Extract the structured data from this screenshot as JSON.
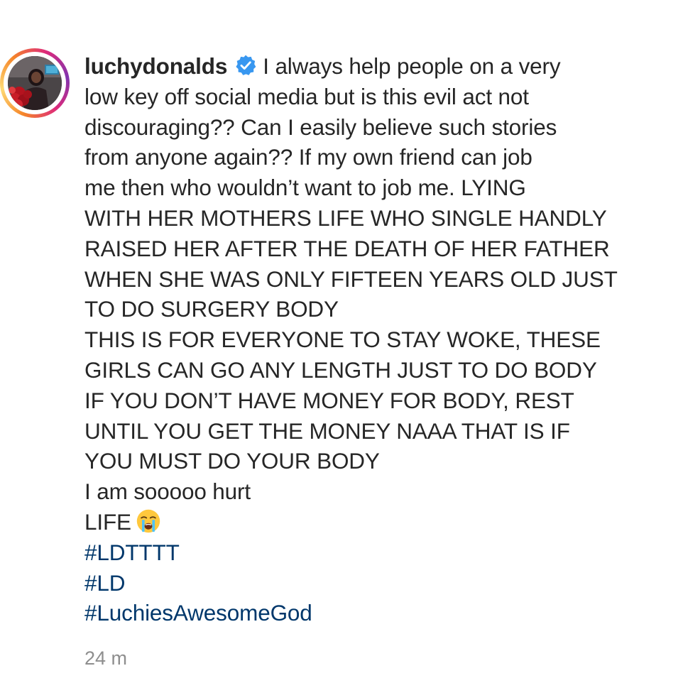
{
  "post": {
    "username": "luchydonalds",
    "verified_icon": "verified-badge-icon",
    "caption_first_line": "I always help people on a very",
    "caption_lines": [
      "low key off social media but is this evil act not",
      "discouraging?? Can I easily believe such stories",
      "from anyone again?? If my own friend can job",
      "me then who wouldn’t want to job me. LYING",
      "WITH HER MOTHERS LIFE WHO SINGLE HANDLY",
      "RAISED HER AFTER THE DEATH OF HER FATHER",
      "WHEN SHE WAS ONLY FIFTEEN YEARS OLD JUST",
      "TO DO SURGERY BODY",
      "THIS IS FOR EVERYONE TO STAY WOKE, THESE",
      "GIRLS CAN GO ANY LENGTH JUST TO DO BODY",
      "IF YOU DON’T HAVE MONEY FOR BODY, REST",
      "UNTIL YOU GET THE MONEY NAAA THAT IS IF",
      "YOU MUST DO YOUR BODY",
      "I am sooooo hurt"
    ],
    "life_text": "LIFE",
    "emoji_icon": "loudly-crying-face-icon",
    "hashtags": [
      "#LDTTTT",
      "#LD",
      "#LuchiesAwesomeGod"
    ],
    "timestamp": "24 m"
  },
  "colors": {
    "text": "#262626",
    "hashtag": "#00376b",
    "timestamp": "#8e8e8e",
    "verified": "#3897f0"
  }
}
